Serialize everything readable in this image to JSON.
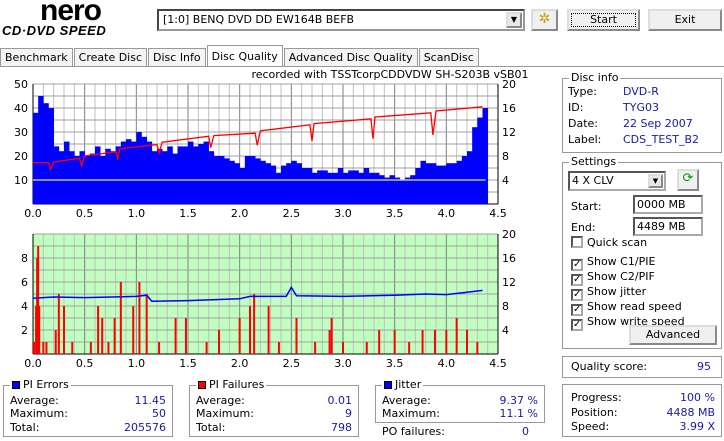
{
  "app": {
    "logo_main": "nero",
    "logo_sub": "CD·DVD SPEED"
  },
  "toolbar": {
    "drive": "[1:0]  BENQ DVD DD EW164B BEFB",
    "start_label": "Start",
    "exit_label": "Exit",
    "config_icon": "drive-config-icon"
  },
  "tabs": [
    {
      "label": "Benchmark"
    },
    {
      "label": "Create Disc"
    },
    {
      "label": "Disc Info"
    },
    {
      "label": "Disc Quality",
      "active": true
    },
    {
      "label": "Advanced Disc Quality"
    },
    {
      "label": "ScanDisc"
    }
  ],
  "chart_caption": "recorded with TSSTcorpCDDVDW SH-S203B  vSB01",
  "chart_data": [
    {
      "type": "bar+line",
      "name": "PI errors / read speed",
      "xlim": [
        0,
        4.5
      ],
      "xticks": [
        "0.0",
        "0.5",
        "1.0",
        "1.5",
        "2.0",
        "2.5",
        "3.0",
        "3.5",
        "4.0",
        "4.5"
      ],
      "ylim": [
        0,
        50
      ],
      "yticks": [
        "10",
        "20",
        "30",
        "40",
        "50"
      ],
      "y2lim": [
        0,
        20
      ],
      "y2ticks": [
        "4",
        "8",
        "12",
        "16",
        "20"
      ],
      "grid": true,
      "colors": {
        "bars": "#0000ff",
        "line": "#ff0000",
        "background": "#ffffff",
        "threshold": "#c0c0c0"
      },
      "pie_x_start": 0,
      "pie_x_step": 0.05,
      "pie_values": [
        38,
        45,
        42,
        40,
        24,
        22,
        26,
        22,
        20,
        22,
        20,
        21,
        24,
        20,
        23,
        22,
        24,
        26,
        27,
        26,
        30,
        28,
        26,
        22,
        23,
        22,
        24,
        21,
        24,
        24,
        26,
        24,
        25,
        26,
        22,
        20,
        20,
        19,
        18,
        17,
        15,
        20,
        20,
        19,
        18,
        17,
        16,
        13,
        16,
        17,
        18,
        17,
        15,
        15,
        13,
        14,
        14,
        13,
        13,
        15,
        13,
        14,
        14,
        13,
        15,
        13,
        13,
        12,
        11,
        12,
        11,
        10,
        11,
        12,
        15,
        18,
        17,
        17,
        16,
        16,
        17,
        17,
        18,
        20,
        22,
        32,
        36,
        40
      ],
      "read_speed": [
        [
          0,
          6.9
        ],
        [
          0.15,
          6.9
        ],
        [
          0.17,
          5.8
        ],
        [
          0.2,
          7
        ],
        [
          0.45,
          7.6
        ],
        [
          0.47,
          6.4
        ],
        [
          0.5,
          8
        ],
        [
          0.8,
          8.7
        ],
        [
          0.82,
          7.6
        ],
        [
          0.84,
          9.2
        ],
        [
          1.2,
          9.9
        ],
        [
          1.22,
          8.5
        ],
        [
          1.25,
          10.3
        ],
        [
          1.7,
          11.3
        ],
        [
          1.72,
          9.4
        ],
        [
          1.75,
          11.4
        ],
        [
          2.15,
          11.8
        ],
        [
          2.17,
          9.8
        ],
        [
          2.2,
          12.2
        ],
        [
          2.68,
          13.2
        ],
        [
          2.7,
          10.5
        ],
        [
          2.72,
          13.4
        ],
        [
          3.27,
          14.2
        ],
        [
          3.29,
          10.9
        ],
        [
          3.31,
          14.5
        ],
        [
          3.85,
          15.2
        ],
        [
          3.87,
          11.5
        ],
        [
          3.9,
          15.5
        ],
        [
          4.35,
          16.2
        ]
      ],
      "threshold": 10
    },
    {
      "type": "bar+line",
      "name": "PI failures / jitter",
      "xlim": [
        0,
        4.5
      ],
      "xticks": [
        "0.0",
        "0.5",
        "1.0",
        "1.5",
        "2.0",
        "2.5",
        "3.0",
        "3.5",
        "4.0",
        "4.5"
      ],
      "ylim": [
        0,
        10
      ],
      "yticks": [
        "2",
        "4",
        "6",
        "8"
      ],
      "y2lim": [
        0,
        20
      ],
      "y2ticks": [
        "4",
        "8",
        "12",
        "16",
        "20"
      ],
      "grid": true,
      "colors": {
        "bars": "#ff0000",
        "line": "#0000ff",
        "background": "#c0ffc0"
      },
      "pif": [
        [
          0.01,
          1
        ],
        [
          0.03,
          4
        ],
        [
          0.04,
          8
        ],
        [
          0.05,
          9
        ],
        [
          0.06,
          4
        ],
        [
          0.1,
          1
        ],
        [
          0.13,
          1
        ],
        [
          0.22,
          2
        ],
        [
          0.25,
          5
        ],
        [
          0.3,
          4
        ],
        [
          0.38,
          1
        ],
        [
          0.56,
          1
        ],
        [
          0.63,
          4
        ],
        [
          0.67,
          3
        ],
        [
          0.73,
          1
        ],
        [
          0.79,
          3
        ],
        [
          0.85,
          6
        ],
        [
          0.97,
          4
        ],
        [
          1.03,
          6
        ],
        [
          1.1,
          5
        ],
        [
          1.22,
          1
        ],
        [
          1.38,
          3
        ],
        [
          1.48,
          3
        ],
        [
          1.68,
          1
        ],
        [
          1.8,
          2
        ],
        [
          2.0,
          3
        ],
        [
          2.1,
          4
        ],
        [
          2.14,
          5
        ],
        [
          2.28,
          4
        ],
        [
          2.38,
          1
        ],
        [
          2.55,
          3
        ],
        [
          2.73,
          1
        ],
        [
          2.87,
          2
        ],
        [
          2.89,
          3
        ],
        [
          3.0,
          1
        ],
        [
          3.23,
          1
        ],
        [
          3.35,
          2
        ],
        [
          3.5,
          2
        ],
        [
          3.64,
          1
        ],
        [
          3.77,
          2
        ],
        [
          3.89,
          2
        ],
        [
          4.0,
          2
        ],
        [
          4.1,
          3
        ],
        [
          4.2,
          2
        ],
        [
          4.3,
          1
        ]
      ],
      "jitter": [
        [
          0,
          9.3
        ],
        [
          0.2,
          9.5
        ],
        [
          0.5,
          9.4
        ],
        [
          1.0,
          9.6
        ],
        [
          1.1,
          9.8
        ],
        [
          1.15,
          8.8
        ],
        [
          1.5,
          8.9
        ],
        [
          2.0,
          9.2
        ],
        [
          2.1,
          9.6
        ],
        [
          2.45,
          9.6
        ],
        [
          2.5,
          11.1
        ],
        [
          2.55,
          9.7
        ],
        [
          3.0,
          9.6
        ],
        [
          3.5,
          9.8
        ],
        [
          3.8,
          10.0
        ],
        [
          4.0,
          9.9
        ],
        [
          4.2,
          10.3
        ],
        [
          4.35,
          10.6
        ]
      ]
    }
  ],
  "disc_info": {
    "title": "Disc info",
    "type_label": "Type:",
    "type": "DVD-R",
    "id_label": "ID:",
    "id": "TYG03",
    "date_label": "Date:",
    "date": "22 Sep 2007",
    "label_label": "Label:",
    "label": "CDS_TEST_B2"
  },
  "settings": {
    "title": "Settings",
    "speed": "4 X CLV",
    "start_label": "Start:",
    "start": "0000 MB",
    "end_label": "End:",
    "end": "4489 MB",
    "checks": [
      {
        "label": "Quick scan",
        "checked": false
      },
      {
        "label": "Show C1/PIE",
        "checked": true
      },
      {
        "label": "Show C2/PIF",
        "checked": true
      },
      {
        "label": "Show jitter",
        "checked": true
      },
      {
        "label": "Show read speed",
        "checked": true
      },
      {
        "label": "Show write speed",
        "checked": true
      }
    ],
    "advanced_label": "Advanced"
  },
  "quality": {
    "label": "Quality score:",
    "value": "95"
  },
  "pi_errors": {
    "title": "PI Errors",
    "color": "#0000ff",
    "avg_label": "Average:",
    "avg": "11.45",
    "max_label": "Maximum:",
    "max": "50",
    "total_label": "Total:",
    "total": "205576"
  },
  "pi_failures": {
    "title": "PI Failures",
    "color": "#ff0000",
    "avg_label": "Average:",
    "avg": "0.01",
    "max_label": "Maximum:",
    "max": "9",
    "total_label": "Total:",
    "total": "798"
  },
  "jitter": {
    "title": "Jitter",
    "color": "#0000ff",
    "avg_label": "Average:",
    "avg": "9.37 %",
    "max_label": "Maximum:",
    "max": "11.1 %",
    "po_label": "PO failures:",
    "po": "0"
  },
  "progress": {
    "progress_label": "Progress:",
    "progress": "100 %",
    "position_label": "Position:",
    "position": "4488 MB",
    "speed_label": "Speed:",
    "speed": "3.99 X"
  }
}
